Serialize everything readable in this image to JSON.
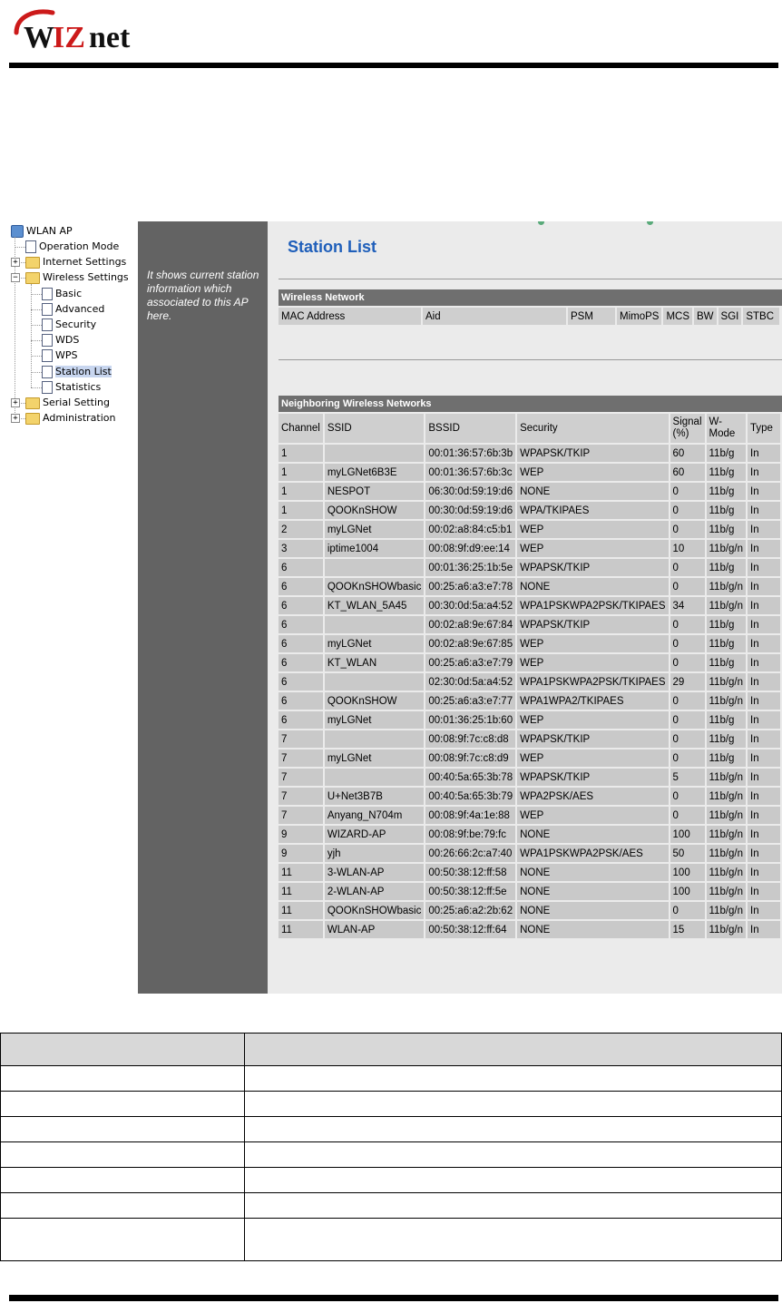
{
  "brand": {
    "logo_text": "WIZnet",
    "logo_color": "#cc1a1a"
  },
  "tree": {
    "root": "WLAN AP",
    "items": [
      {
        "label": "Operation Mode",
        "kind": "page",
        "level": 1
      },
      {
        "label": "Internet Settings",
        "kind": "folder",
        "level": 1,
        "toggle": "+"
      },
      {
        "label": "Wireless Settings",
        "kind": "folder",
        "level": 1,
        "toggle": "-"
      },
      {
        "label": "Basic",
        "kind": "page",
        "level": 2
      },
      {
        "label": "Advanced",
        "kind": "page",
        "level": 2
      },
      {
        "label": "Security",
        "kind": "page",
        "level": 2
      },
      {
        "label": "WDS",
        "kind": "page",
        "level": 2
      },
      {
        "label": "WPS",
        "kind": "page",
        "level": 2
      },
      {
        "label": "Station List",
        "kind": "page",
        "level": 2,
        "selected": true
      },
      {
        "label": "Statistics",
        "kind": "page",
        "level": 2
      },
      {
        "label": "Serial Setting",
        "kind": "folder",
        "level": 1,
        "toggle": "+"
      },
      {
        "label": "Administration",
        "kind": "folder",
        "level": 1,
        "toggle": "+"
      }
    ]
  },
  "help_text": "It shows current station information which associated to this AP here.",
  "page_title": "Station List",
  "wireless_network": {
    "header": "Wireless Network",
    "columns": [
      "MAC Address",
      "Aid",
      "PSM",
      "MimoPS",
      "MCS",
      "BW",
      "SGI",
      "STBC"
    ]
  },
  "neighbors": {
    "header": "Neighboring Wireless Networks",
    "columns": [
      "Channel",
      "SSID",
      "BSSID",
      "Security",
      "Signal (%)",
      "W-Mode",
      "Type"
    ],
    "rows": [
      [
        "1",
        "",
        "00:01:36:57:6b:3b",
        "WPAPSK/TKIP",
        "60",
        "11b/g",
        "In"
      ],
      [
        "1",
        "myLGNet6B3E",
        "00:01:36:57:6b:3c",
        "WEP",
        "60",
        "11b/g",
        "In"
      ],
      [
        "1",
        "NESPOT",
        "06:30:0d:59:19:d6",
        "NONE",
        "0",
        "11b/g",
        "In"
      ],
      [
        "1",
        "QOOKnSHOW",
        "00:30:0d:59:19:d6",
        "WPA/TKIPAES",
        "0",
        "11b/g",
        "In"
      ],
      [
        "2",
        "myLGNet",
        "00:02:a8:84:c5:b1",
        "WEP",
        "0",
        "11b/g",
        "In"
      ],
      [
        "3",
        "iptime1004",
        "00:08:9f:d9:ee:14",
        "WEP",
        "10",
        "11b/g/n",
        "In"
      ],
      [
        "6",
        "",
        "00:01:36:25:1b:5e",
        "WPAPSK/TKIP",
        "0",
        "11b/g",
        "In"
      ],
      [
        "6",
        "QOOKnSHOWbasic",
        "00:25:a6:a3:e7:78",
        "NONE",
        "0",
        "11b/g/n",
        "In"
      ],
      [
        "6",
        "KT_WLAN_5A45",
        "00:30:0d:5a:a4:52",
        "WPA1PSKWPA2PSK/TKIPAES",
        "34",
        "11b/g/n",
        "In"
      ],
      [
        "6",
        "",
        "00:02:a8:9e:67:84",
        "WPAPSK/TKIP",
        "0",
        "11b/g",
        "In"
      ],
      [
        "6",
        "myLGNet",
        "00:02:a8:9e:67:85",
        "WEP",
        "0",
        "11b/g",
        "In"
      ],
      [
        "6",
        "KT_WLAN",
        "00:25:a6:a3:e7:79",
        "WEP",
        "0",
        "11b/g",
        "In"
      ],
      [
        "6",
        "",
        "02:30:0d:5a:a4:52",
        "WPA1PSKWPA2PSK/TKIPAES",
        "29",
        "11b/g/n",
        "In"
      ],
      [
        "6",
        "QOOKnSHOW",
        "00:25:a6:a3:e7:77",
        "WPA1WPA2/TKIPAES",
        "0",
        "11b/g/n",
        "In"
      ],
      [
        "6",
        "myLGNet",
        "00:01:36:25:1b:60",
        "WEP",
        "0",
        "11b/g",
        "In"
      ],
      [
        "7",
        "",
        "00:08:9f:7c:c8:d8",
        "WPAPSK/TKIP",
        "0",
        "11b/g",
        "In"
      ],
      [
        "7",
        "myLGNet",
        "00:08:9f:7c:c8:d9",
        "WEP",
        "0",
        "11b/g",
        "In"
      ],
      [
        "7",
        "",
        "00:40:5a:65:3b:78",
        "WPAPSK/TKIP",
        "5",
        "11b/g/n",
        "In"
      ],
      [
        "7",
        "U+Net3B7B",
        "00:40:5a:65:3b:79",
        "WPA2PSK/AES",
        "0",
        "11b/g/n",
        "In"
      ],
      [
        "7",
        "Anyang_N704m",
        "00:08:9f:4a:1e:88",
        "WEP",
        "0",
        "11b/g/n",
        "In"
      ],
      [
        "9",
        "WIZARD-AP",
        "00:08:9f:be:79:fc",
        "NONE",
        "100",
        "11b/g/n",
        "In"
      ],
      [
        "9",
        "yjh",
        "00:26:66:2c:a7:40",
        "WPA1PSKWPA2PSK/AES",
        "50",
        "11b/g/n",
        "In"
      ],
      [
        "11",
        "3-WLAN-AP",
        "00:50:38:12:ff:58",
        "NONE",
        "100",
        "11b/g/n",
        "In"
      ],
      [
        "11",
        "2-WLAN-AP",
        "00:50:38:12:ff:5e",
        "NONE",
        "100",
        "11b/g/n",
        "In"
      ],
      [
        "11",
        "QOOKnSHOWbasic",
        "00:25:a6:a2:2b:62",
        "NONE",
        "0",
        "11b/g/n",
        "In"
      ],
      [
        "11",
        "WLAN-AP",
        "00:50:38:12:ff:64",
        "NONE",
        "15",
        "11b/g/n",
        "In"
      ]
    ]
  }
}
